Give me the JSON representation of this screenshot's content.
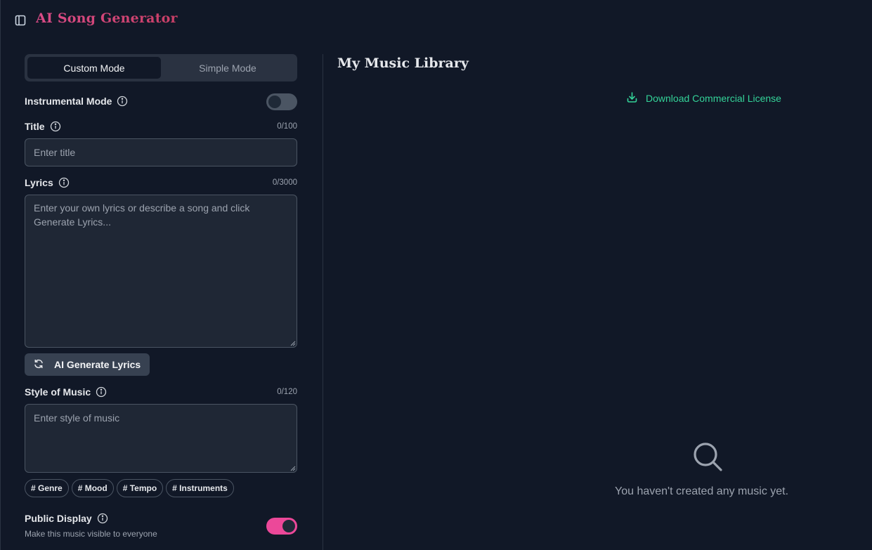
{
  "header": {
    "title": "AI Song Generator"
  },
  "mode_switch": {
    "custom_label": "Custom Mode",
    "simple_label": "Simple Mode",
    "active": "custom"
  },
  "instrumental": {
    "label": "Instrumental Mode",
    "enabled": false
  },
  "title_field": {
    "label": "Title",
    "counter": "0/100",
    "placeholder": "Enter title",
    "value": ""
  },
  "lyrics_field": {
    "label": "Lyrics",
    "counter": "0/3000",
    "placeholder": "Enter your own lyrics or describe a song and click Generate Lyrics...",
    "value": ""
  },
  "generate_lyrics": {
    "label": "AI Generate Lyrics"
  },
  "style_field": {
    "label": "Style of Music",
    "counter": "0/120",
    "placeholder": "Enter style of music",
    "value": ""
  },
  "style_tags": [
    {
      "label": "# Genre"
    },
    {
      "label": "# Mood"
    },
    {
      "label": "# Tempo"
    },
    {
      "label": "# Instruments"
    }
  ],
  "public_display": {
    "label": "Public Display",
    "description": "Make this music visible to everyone",
    "enabled": true
  },
  "library": {
    "title": "My Music Library",
    "download_label": "Download Commercial License",
    "empty_message": "You haven't created any music yet."
  },
  "colors": {
    "background": "#111827",
    "accent_pink": "#ec4899",
    "accent_green": "#34d399"
  },
  "icons": {
    "sidebar_toggle": "sidebar-panel-icon",
    "info": "info-circle-icon",
    "refresh": "refresh-icon",
    "download": "download-icon",
    "empty": "search-icon"
  }
}
